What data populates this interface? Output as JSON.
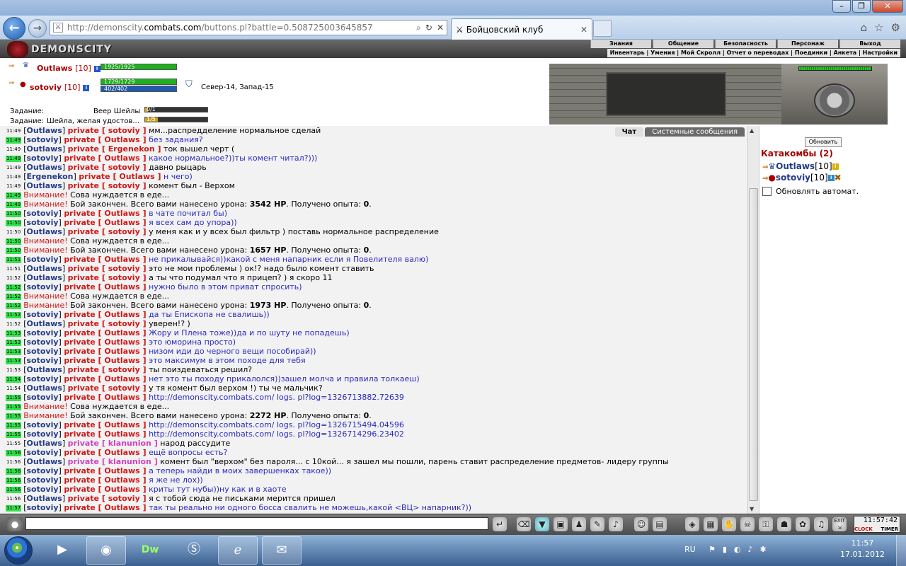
{
  "browser": {
    "url_prefix": "http://demonscity.",
    "url_domain": "combats.com",
    "url_path": "/buttons.pl?battle=0.508725003645857",
    "tab_title": "Бойцовский клуб",
    "back_icon": "back-arrow-icon",
    "forward_icon": "forward-arrow-icon"
  },
  "game": {
    "logo_text": "DEMONSCITY",
    "menu_top": [
      "Знания",
      "Общение",
      "Безопасность",
      "Персонаж",
      "Выход"
    ],
    "menu_sub": "Инвентарь | Умения | Мой Скролл | Отчет о переводах | Поединки | Анкета | Настройки"
  },
  "status": {
    "player1": {
      "name": "Outlaws",
      "level": "[10]",
      "hp": "1925/1925"
    },
    "player2": {
      "name": "sotoviy",
      "level": "[10]",
      "hp": "1729/1729",
      "mana": "402/402"
    },
    "location_coords": "Север-14, Запад-15",
    "task1_label": "Задание:",
    "task1_name": "Веер Шейлы",
    "task1_progress": "0/1",
    "task2_label": "Задание:",
    "task2_name": "Шейла, желая удостов...",
    "task2_progress": "1/5"
  },
  "chat_tabs": [
    "Чат",
    "Системные сообщения"
  ],
  "messages": [
    {
      "t": "11:49",
      "hl": false,
      "nick": "Outlaws",
      "priv": "sotoviy",
      "text": "мм...распредделение нормальное сделай",
      "own": false
    },
    {
      "t": "11:49",
      "hl": true,
      "nick": "sotoviy",
      "priv": "Outlaws",
      "text": "без задания?",
      "own": true
    },
    {
      "t": "11:49",
      "hl": false,
      "nick": "Outlaws",
      "priv": "Ergenekon",
      "text": "ток вышел черт (",
      "own": false
    },
    {
      "t": "11:49",
      "hl": true,
      "nick": "sotoviy",
      "priv": "Outlaws",
      "text": "какое нормальное?))ты комент читал?)))",
      "own": true
    },
    {
      "t": "11:49",
      "hl": false,
      "nick": "Outlaws",
      "priv": "sotoviy",
      "text": "давно рыцарь",
      "own": false
    },
    {
      "t": "11:49",
      "hl": false,
      "nick": "Ergenekon",
      "priv": "Outlaws",
      "text": "н чего)",
      "own": true
    },
    {
      "t": "11:49",
      "hl": false,
      "nick": "Outlaws",
      "priv": "sotoviy",
      "text": "комент был - Верхом",
      "own": false
    },
    {
      "t": "11:49",
      "hl": true,
      "warn": "Внимание!",
      "text": "Сова нуждается в еде..."
    },
    {
      "t": "11:49",
      "hl": true,
      "warn": "Внимание!",
      "text": "Бой закончен. Всего вами нанесено урона: ",
      "dmg": "3542 HP",
      "rest": ". Получено опыта: ",
      "exp": "0",
      "end": "."
    },
    {
      "t": "11:50",
      "hl": true,
      "nick": "sotoviy",
      "priv": "Outlaws",
      "text": "в чате почитал бы)",
      "own": true
    },
    {
      "t": "11:50",
      "hl": true,
      "nick": "sotoviy",
      "priv": "Outlaws",
      "text": "я всех сам до упора))",
      "own": true
    },
    {
      "t": "11:50",
      "hl": false,
      "nick": "Outlaws",
      "priv": "sotoviy",
      "text": "у меня как и у всех был фильтр ) поставь нормальное распределение",
      "own": false
    },
    {
      "t": "11:50",
      "hl": true,
      "warn": "Внимание!",
      "text": "Сова нуждается в еде..."
    },
    {
      "t": "11:50",
      "hl": true,
      "warn": "Внимание!",
      "text": "Бой закончен. Всего вами нанесено урона: ",
      "dmg": "1657 HP",
      "rest": ". Получено опыта: ",
      "exp": "0",
      "end": "."
    },
    {
      "t": "11:51",
      "hl": true,
      "nick": "sotoviy",
      "priv": "Outlaws",
      "text": "не прикалывайся))какой с меня напарник если я Повелителя валю)",
      "own": true
    },
    {
      "t": "11:51",
      "hl": false,
      "nick": "Outlaws",
      "priv": "sotoviy",
      "text": "это не мои проблемы ) ок!? надо было комент ставить",
      "own": false
    },
    {
      "t": "11:52",
      "hl": false,
      "nick": "Outlaws",
      "priv": "sotoviy",
      "text": "а ты что подумал что я прицеп? ) я скоро 11",
      "own": false
    },
    {
      "t": "11:52",
      "hl": true,
      "nick": "sotoviy",
      "priv": "Outlaws",
      "text": "нужно было в этом приват спросить)",
      "own": true
    },
    {
      "t": "11:52",
      "hl": true,
      "warn": "Внимание!",
      "text": "Сова нуждается в еде..."
    },
    {
      "t": "11:52",
      "hl": true,
      "warn": "Внимание!",
      "text": "Бой закончен. Всего вами нанесено урона: ",
      "dmg": "1973 HP",
      "rest": ". Получено опыта: ",
      "exp": "0",
      "end": "."
    },
    {
      "t": "11:52",
      "hl": true,
      "nick": "sotoviy",
      "priv": "Outlaws",
      "text": "да ты Епископа не свалишь))",
      "own": true
    },
    {
      "t": "11:52",
      "hl": false,
      "nick": "Outlaws",
      "priv": "sotoviy",
      "text": "уверен!? )",
      "own": false
    },
    {
      "t": "11:53",
      "hl": true,
      "nick": "sotoviy",
      "priv": "Outlaws",
      "text": "Жору и Плена тоже))да и по шуту не попадешь)",
      "own": true
    },
    {
      "t": "11:53",
      "hl": true,
      "nick": "sotoviy",
      "priv": "Outlaws",
      "text": "это юморина просто)",
      "own": true
    },
    {
      "t": "11:53",
      "hl": true,
      "nick": "sotoviy",
      "priv": "Outlaws",
      "text": "низом иди до черного вещи пособирай))",
      "own": true
    },
    {
      "t": "11:53",
      "hl": true,
      "nick": "sotoviy",
      "priv": "Outlaws",
      "text": "это максимум в этом походе для тебя",
      "own": true
    },
    {
      "t": "11:53",
      "hl": false,
      "nick": "Outlaws",
      "priv": "sotoviy",
      "text": "ты поиздеваться решил?",
      "own": false
    },
    {
      "t": "11:54",
      "hl": true,
      "nick": "sotoviy",
      "priv": "Outlaws",
      "text": "нет это ты походу прикалолся))зашел молча и правила толкаеш)",
      "own": true
    },
    {
      "t": "11:54",
      "hl": false,
      "nick": "Outlaws",
      "priv": "sotoviy",
      "text": "у тя комент был верхом !) ты че мальчик?",
      "own": false
    },
    {
      "t": "11:55",
      "hl": true,
      "nick": "sotoviy",
      "priv": "Outlaws",
      "text": "http://demonscity.combats.com/ logs. pl?log=1326713882.72639",
      "own": true
    },
    {
      "t": "11:55",
      "hl": true,
      "warn": "Внимание!",
      "text": "Сова нуждается в еде..."
    },
    {
      "t": "11:55",
      "hl": true,
      "warn": "Внимание!",
      "text": "Бой закончен. Всего вами нанесено урона: ",
      "dmg": "2272 HP",
      "rest": ". Получено опыта: ",
      "exp": "0",
      "end": "."
    },
    {
      "t": "11:55",
      "hl": true,
      "nick": "sotoviy",
      "priv": "Outlaws",
      "text": "http://demonscity.combats.com/ logs. pl?log=1326715494.04596",
      "own": true
    },
    {
      "t": "11:55",
      "hl": true,
      "nick": "sotoviy",
      "priv": "Outlaws",
      "text": "http://demonscity.combats.com/ logs. pl?log=1326714296.23402",
      "own": true
    },
    {
      "t": "11:55",
      "hl": false,
      "nick": "Outlaws",
      "priv": "klanunion",
      "privmag": true,
      "text": "народ рассудите",
      "own": false
    },
    {
      "t": "11:56",
      "hl": true,
      "nick": "sotoviy",
      "priv": "Outlaws",
      "text": "ещё вопросы есть?",
      "own": true
    },
    {
      "t": "11:56",
      "hl": false,
      "nick": "Outlaws",
      "priv": "klanunion",
      "privmag": true,
      "text": "комент был \"верхом\" без пароля... с 10кой... я зашел мы пошли, парень ставит распределение предметов- лидеру группы",
      "own": false
    },
    {
      "t": "11:56",
      "hl": true,
      "nick": "sotoviy",
      "priv": "Outlaws",
      "text": "а теперь найди в моих завершенках такое))",
      "own": true
    },
    {
      "t": "11:56",
      "hl": true,
      "nick": "sotoviy",
      "priv": "Outlaws",
      "text": "я же не лох))",
      "own": true
    },
    {
      "t": "11:56",
      "hl": true,
      "nick": "sotoviy",
      "priv": "Outlaws",
      "text": "криты тут нубы))ну как и в хаоте",
      "own": true
    },
    {
      "t": "11:56",
      "hl": false,
      "nick": "Outlaws",
      "priv": "sotoviy",
      "text": "я с тобой сюда не письками мерится пришел",
      "own": false
    },
    {
      "t": "11:57",
      "hl": true,
      "nick": "sotoviy",
      "priv": "Outlaws",
      "text": "так ты реально ни одного босса свалить не можешь,какой <ВЦ> напарник?))",
      "own": true
    }
  ],
  "right_panel": {
    "refresh": "Обновить",
    "location": "Катакомбы (2)",
    "players": [
      {
        "name": "Outlaws",
        "level": "[10]"
      },
      {
        "name": "sotoviy",
        "level": "[10]"
      }
    ],
    "auto_refresh": "Обновлять автомат."
  },
  "toolbar": {
    "clock_time": "11:57:42",
    "clock_label": "CLOCK",
    "timer_label": "TIMER",
    "exit_label": "EXIT"
  },
  "taskbar": {
    "lang": "RU",
    "time": "11:57",
    "date": "17.01.2012"
  }
}
